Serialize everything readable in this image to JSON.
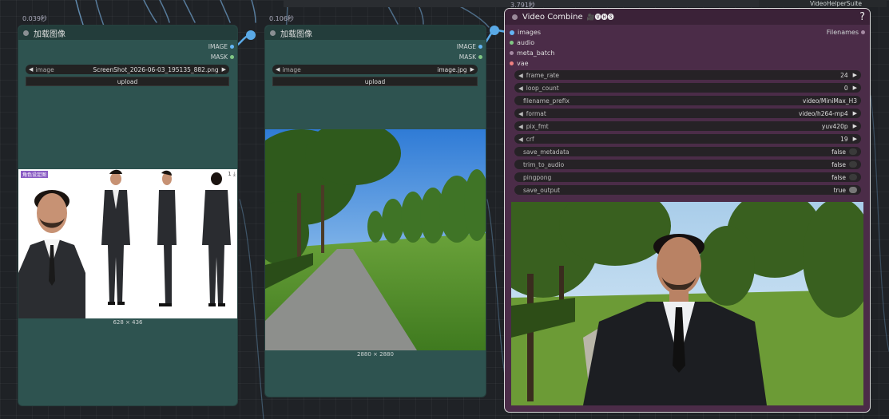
{
  "colors": {
    "teal_node": "#2e5350",
    "teal_header": "#233d3b",
    "video_node": "#4b2c48",
    "wire_blue": "#5aa9e6",
    "image_socket": "#64b5f6",
    "mask_socket": "#81c784"
  },
  "top_right_label": "VideoHelperSuite",
  "node1": {
    "time": "0.039秒",
    "title": "加载图像",
    "outputs": [
      "IMAGE",
      "MASK"
    ],
    "image_label": "image",
    "image_value": "ScreenShot_2026-06-03_195135_882.png",
    "upload_label": "upload",
    "image_size": "628 × 436",
    "preview_badge": "角色设定图"
  },
  "node2": {
    "time": "0.106秒",
    "title": "加载图像",
    "outputs": [
      "IMAGE",
      "MASK"
    ],
    "image_label": "image",
    "image_value": "image.jpg",
    "upload_label": "upload",
    "image_size": "2880 × 2880"
  },
  "video": {
    "time": "3.791秒",
    "title": "Video Combine",
    "title_icons": "🎥🅥🅗🅢",
    "help": "?",
    "inputs": [
      "images",
      "audio",
      "meta_batch",
      "vae"
    ],
    "output": "Filenames",
    "widgets": [
      {
        "label": "frame_rate",
        "value": "24",
        "kind": "number"
      },
      {
        "label": "loop_count",
        "value": "0",
        "kind": "number"
      },
      {
        "label": "filename_prefix",
        "value": "video/MiniMax_H3",
        "kind": "text"
      },
      {
        "label": "format",
        "value": "video/h264-mp4",
        "kind": "combo"
      },
      {
        "label": "pix_fmt",
        "value": "yuv420p",
        "kind": "combo"
      },
      {
        "label": "crf",
        "value": "19",
        "kind": "number"
      },
      {
        "label": "save_metadata",
        "value": "false",
        "kind": "toggle"
      },
      {
        "label": "trim_to_audio",
        "value": "false",
        "kind": "toggle"
      },
      {
        "label": "pingpong",
        "value": "false",
        "kind": "toggle"
      },
      {
        "label": "save_output",
        "value": "true",
        "kind": "toggle"
      }
    ]
  }
}
